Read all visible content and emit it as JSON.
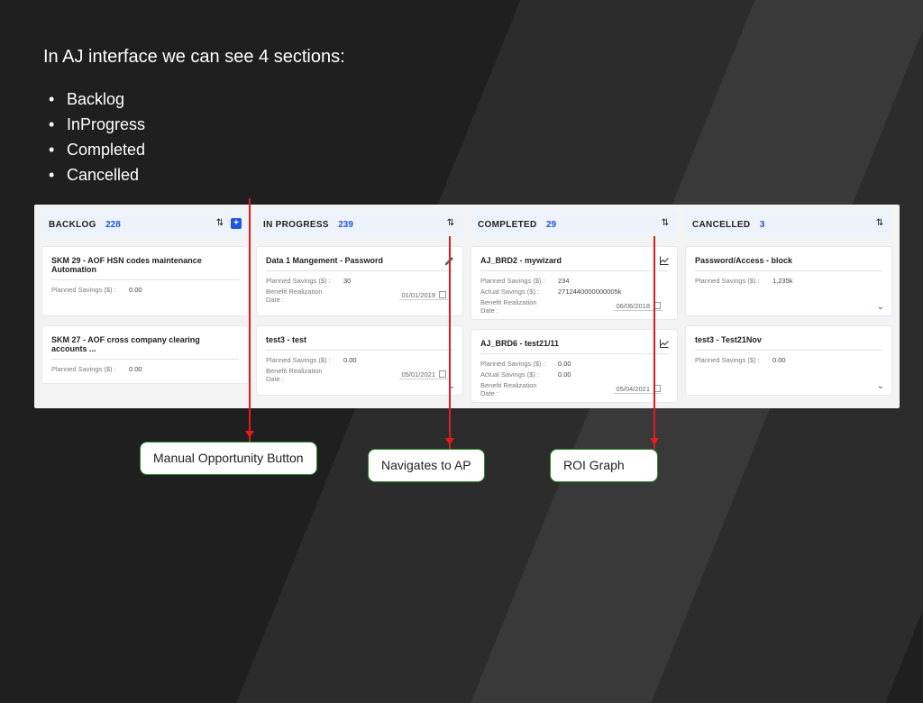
{
  "heading": "In AJ interface we can see 4 sections:",
  "sections": [
    "Backlog",
    "InProgress",
    "Completed",
    "Cancelled"
  ],
  "board": {
    "lanes": [
      {
        "title": "BACKLOG",
        "count": "228",
        "hasAdd": true,
        "cards": [
          {
            "title": "SKM 29 - AOF HSN codes maintenance Automation",
            "rows": [
              {
                "label": "Planned Savings ($) :",
                "value": "0.00"
              }
            ]
          },
          {
            "title": "SKM 27 - AOF cross company clearing accounts ...",
            "rows": [
              {
                "label": "Planned Savings ($) :",
                "value": "0.00"
              }
            ],
            "half": true
          }
        ]
      },
      {
        "title": "IN PROGRESS",
        "count": "239",
        "hasAdd": false,
        "cards": [
          {
            "title": "Data 1 Mangement - Password",
            "icon": "pencil",
            "rows": [
              {
                "label": "Planned Savings ($) :",
                "value": "30"
              },
              {
                "label": "Benefit Realization Date :",
                "date": "01/01/2019"
              }
            ]
          },
          {
            "title": "test3 - test",
            "rows": [
              {
                "label": "Planned Savings ($) :",
                "value": "0.00"
              },
              {
                "label": "Benefit Realization Date :",
                "date": "05/01/2021"
              }
            ],
            "chev": true
          }
        ]
      },
      {
        "title": "COMPLETED",
        "count": "29",
        "hasAdd": false,
        "cards": [
          {
            "title": "AJ_BRD2 - mywizard",
            "icon": "graph",
            "rows": [
              {
                "label": "Planned Savings ($) :",
                "value": "234"
              },
              {
                "label": "Actual Savings ($) :",
                "value": "2712440000000005k"
              },
              {
                "label": "Benefit Realization Date :",
                "date": "06/06/2018"
              }
            ]
          },
          {
            "title": "AJ_BRD6 - test21/11",
            "icon": "graph",
            "rows": [
              {
                "label": "Planned Savings ($) :",
                "value": "0.00"
              },
              {
                "label": "Actual Savings ($) :",
                "value": "0.00"
              },
              {
                "label": "Benefit Realization Date :",
                "date": "05/04/2021"
              }
            ]
          }
        ]
      },
      {
        "title": "CANCELLED",
        "count": "3",
        "hasAdd": false,
        "cards": [
          {
            "title": "Password/Access - block",
            "rows": [
              {
                "label": "Planned Savings ($) :",
                "value": "1,235k"
              }
            ],
            "chev": true
          },
          {
            "title": "test3 - Test21Nov",
            "rows": [
              {
                "label": "Planned Savings ($) :",
                "value": "0.00"
              }
            ],
            "chev": true
          }
        ]
      }
    ]
  },
  "callouts": [
    "Manual Opportunity Button",
    "Navigates to AP",
    "ROI Graph"
  ]
}
